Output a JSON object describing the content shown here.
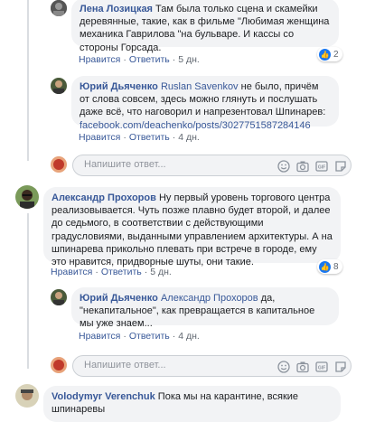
{
  "comments": [
    {
      "author": "Лена Лозицкая",
      "text": "Там была только сцена и скамейки деревянные, такие, как в фильме \"Любимая женщина механика Гаврилова \"на бульваре. И кассы со стороны Горсада.",
      "reactions": "2",
      "like_label": "Нравится",
      "reply_label": "Ответить",
      "time": "5 дн."
    },
    {
      "author": "Юрий Дьяченко",
      "mention": "Ruslan Savenkov",
      "text": "не было, причём от слова совсем, здесь можно глянуть и послушать даже всё, что наговорил и напрезентовал Шпинарев:",
      "link": "facebook.com/deachenko/posts/3027751587284146",
      "like_label": "Нравится",
      "reply_label": "Ответить",
      "time": "4 дн."
    },
    {
      "author": "Александр Прохоров",
      "text": "Ну первый уровень торгового центра реализовывается. Чуть позже плавно будет второй, и далее до седьмого, в соответствии с действующими градусловиями, выданными управлением архитектуры. А на шпинарева прикольно плевать при встрече в городе, ему это нравится, придворные шуты, они такие.",
      "reactions": "8",
      "like_label": "Нравится",
      "reply_label": "Ответить",
      "time": "5 дн."
    },
    {
      "author": "Юрий Дьяченко",
      "mention": "Александр Прохоров",
      "text": "да, \"некапитальное\", как превращается в капитальное мы уже знаем...",
      "like_label": "Нравится",
      "reply_label": "Ответить",
      "time": "4 дн."
    },
    {
      "author": "Volodymyr Verenchuk",
      "text": "Пока мы на карантине, всякие шпинаревы"
    }
  ],
  "reply_input": {
    "placeholder": "Напишите ответ..."
  },
  "icons": [
    "emoji-icon",
    "camera-icon",
    "gif-icon",
    "sticker-icon"
  ]
}
